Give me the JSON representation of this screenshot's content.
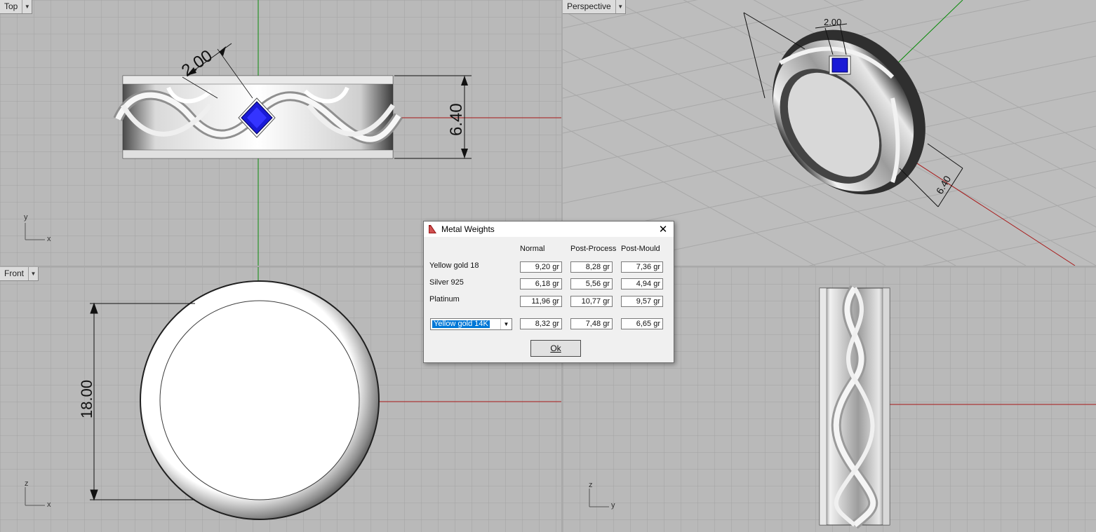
{
  "viewports": {
    "top": {
      "name": "Top",
      "axis_x": "x",
      "axis_y": "y",
      "dims": [
        "2.00",
        "6.40"
      ]
    },
    "perspective": {
      "name": "Perspective",
      "dims": [
        "2.00",
        "6.40"
      ]
    },
    "front": {
      "name": "Front",
      "axis_x": "x",
      "axis_y": "z",
      "dims": [
        "18.00"
      ]
    },
    "right": {
      "axis_x": "y",
      "axis_y": "z"
    }
  },
  "dialog": {
    "title": "Metal Weights",
    "close_icon": "close-icon",
    "columns": [
      "Normal",
      "Post-Process",
      "Post-Mould"
    ],
    "rows": [
      {
        "label": "Yellow gold 18",
        "values": [
          "9,20 gr",
          "8,28 gr",
          "7,36 gr"
        ]
      },
      {
        "label": "Silver 925",
        "values": [
          "6,18 gr",
          "5,56 gr",
          "4,94 gr"
        ]
      },
      {
        "label": "Platinum",
        "values": [
          "11,96 gr",
          "10,77 gr",
          "9,57 gr"
        ]
      }
    ],
    "custom": {
      "selected": "Yellow gold 14K",
      "values": [
        "8,32 gr",
        "7,48 gr",
        "6,65 gr"
      ]
    },
    "ok_label": "Ok"
  },
  "colors": {
    "grid_bg": "#b9b9b9",
    "x_axis": "#a81818",
    "y_axis": "#0a8a0a",
    "gem": "#1a1ad6"
  }
}
